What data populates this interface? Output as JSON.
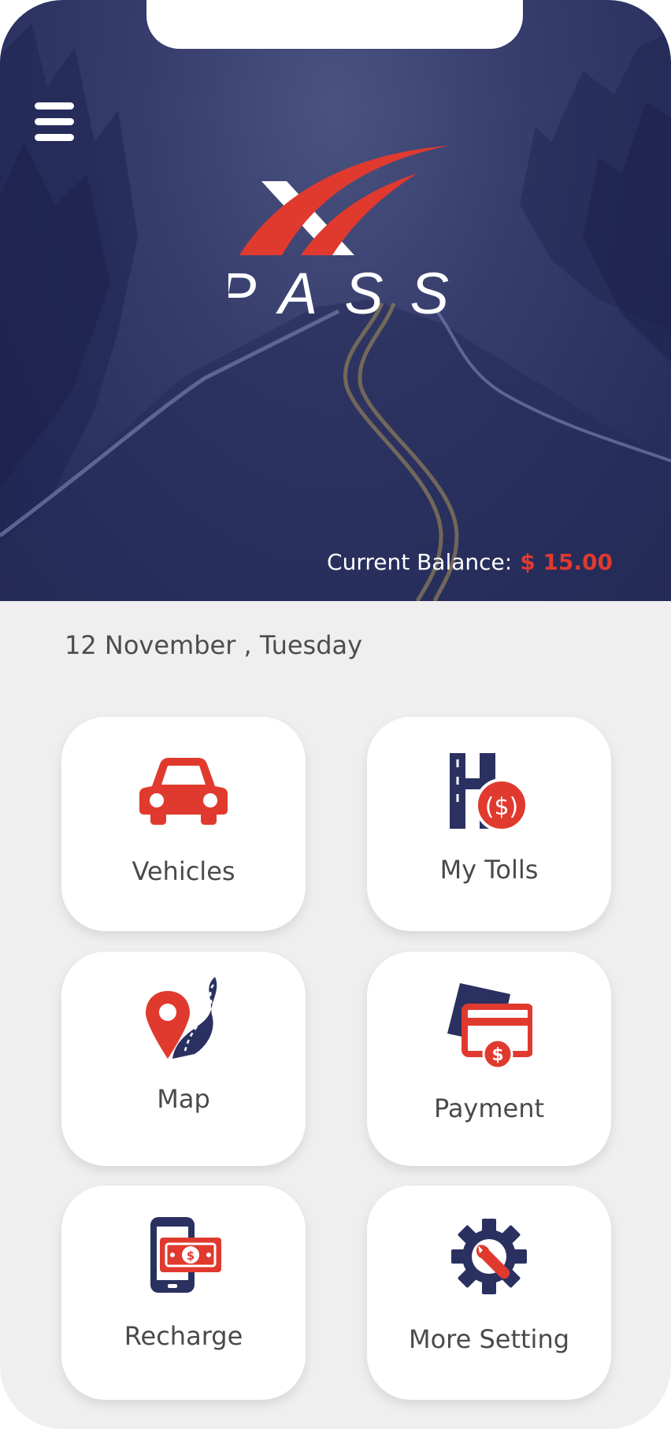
{
  "app": {
    "brand_word": "PASS",
    "brand_mark": "X",
    "colors": {
      "navy": "#2a3160",
      "accent_red": "#e03a2f",
      "background": "#efefef"
    }
  },
  "header": {
    "menu_icon": "hamburger-menu-icon",
    "balance_label": "Current Balance:",
    "balance_value": "$ 15.00"
  },
  "date_text": "12 November , Tuesday",
  "tiles": [
    {
      "label": "Vehicles",
      "icon": "car-icon"
    },
    {
      "label": "My Tolls",
      "icon": "toll-road-dollar-icon"
    },
    {
      "label": "Map",
      "icon": "map-pin-road-icon"
    },
    {
      "label": "Payment",
      "icon": "payment-card-icon"
    },
    {
      "label": "Recharge",
      "icon": "phone-cash-icon"
    },
    {
      "label": "More Setting",
      "icon": "gear-wrench-icon"
    }
  ]
}
